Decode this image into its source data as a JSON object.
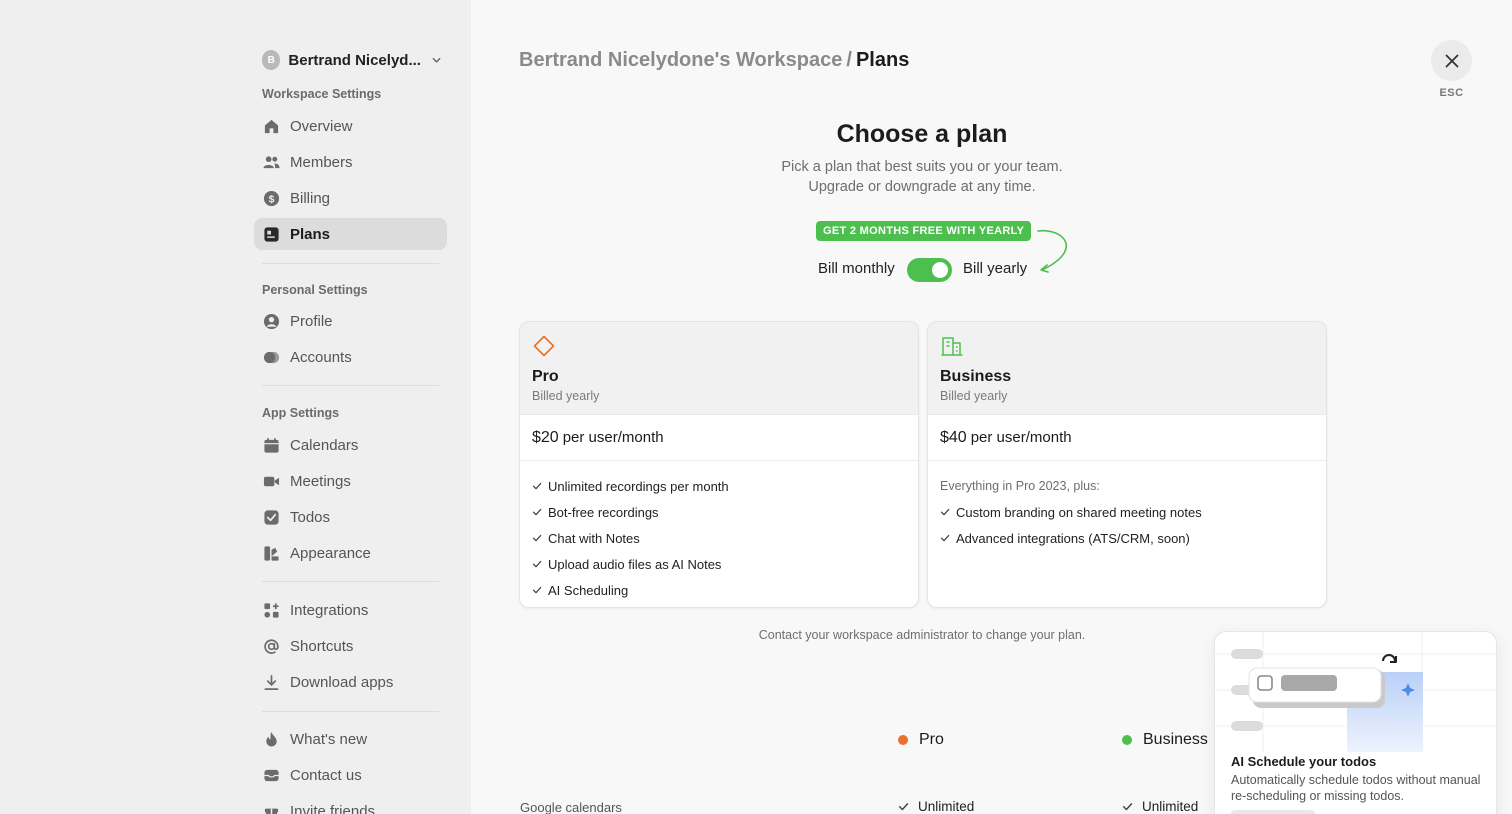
{
  "sidebar": {
    "workspace": {
      "avatar": "B",
      "name": "Bertrand Nicelyd..."
    },
    "sections": {
      "workspace": "Workspace Settings",
      "personal": "Personal Settings",
      "app": "App Settings"
    },
    "items": [
      {
        "label": "Overview",
        "icon": "home-icon"
      },
      {
        "label": "Members",
        "icon": "members-icon"
      },
      {
        "label": "Billing",
        "icon": "dollar-icon"
      },
      {
        "label": "Plans",
        "icon": "plans-icon",
        "active": true
      },
      {
        "label": "Profile",
        "icon": "profile-icon"
      },
      {
        "label": "Accounts",
        "icon": "accounts-icon"
      },
      {
        "label": "Calendars",
        "icon": "calendar-icon"
      },
      {
        "label": "Meetings",
        "icon": "video-icon"
      },
      {
        "label": "Todos",
        "icon": "check-square-icon"
      },
      {
        "label": "Appearance",
        "icon": "appearance-icon"
      },
      {
        "label": "Integrations",
        "icon": "integrations-icon"
      },
      {
        "label": "Shortcuts",
        "icon": "at-icon"
      },
      {
        "label": "Download apps",
        "icon": "download-icon"
      },
      {
        "label": "What's new",
        "icon": "flame-icon"
      },
      {
        "label": "Contact us",
        "icon": "inbox-icon"
      },
      {
        "label": "Invite friends",
        "icon": "gift-icon"
      }
    ]
  },
  "header": {
    "workspace": "Bertrand Nicelydone's Workspace",
    "separator": "/",
    "current": "Plans",
    "esc_label": "ESC"
  },
  "main": {
    "title": "Choose a plan",
    "subtitle": "Pick a plan that best suits you or your team. Upgrade or downgrade at any time.",
    "promo_badge": "GET 2 MONTHS FREE WITH YEARLY",
    "bill_monthly": "Bill monthly",
    "bill_yearly": "Bill yearly",
    "yearly_selected": true,
    "plans": [
      {
        "name": "Pro",
        "billed": "Billed yearly",
        "price": "$20",
        "unit": "per user/month",
        "icon": "diamond-icon",
        "color": "#e8712c",
        "intro": "",
        "features": [
          "Unlimited recordings per month",
          "Bot-free recordings",
          "Chat with Notes",
          "Upload audio files as AI Notes",
          "AI Scheduling"
        ]
      },
      {
        "name": "Business",
        "billed": "Billed yearly",
        "price": "$40",
        "unit": "per user/month",
        "icon": "building-icon",
        "color": "#4cbf4f",
        "intro": "Everything in Pro 2023, plus:",
        "features": [
          "Custom branding on shared meeting notes",
          "Advanced integrations (ATS/CRM, soon)"
        ]
      }
    ],
    "contact_note": "Contact your workspace administrator to change your plan.",
    "comparison": {
      "columns": [
        {
          "name": "Pro",
          "color": "#e8712c"
        },
        {
          "name": "Business",
          "color": "#4cbf4f"
        }
      ],
      "rows": [
        {
          "label": "Google calendars",
          "pro": "Unlimited",
          "business": "Unlimited"
        }
      ]
    }
  },
  "popup": {
    "title": "AI Schedule your todos",
    "description": "Automatically schedule todos without manual re-scheduling or missing todos."
  }
}
